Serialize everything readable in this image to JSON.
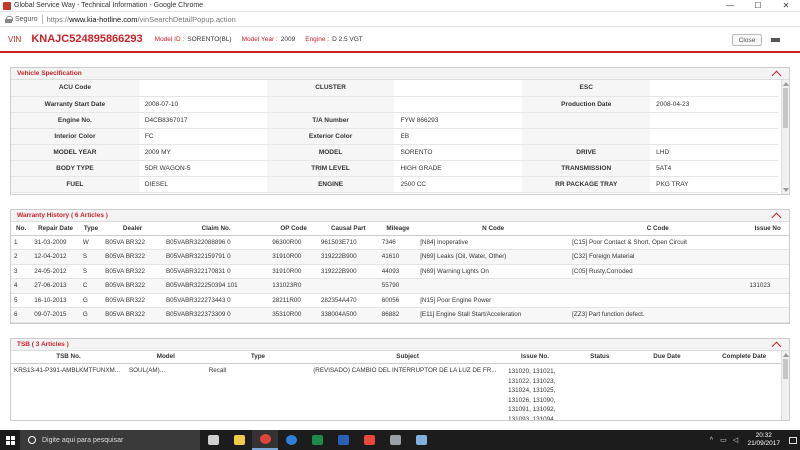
{
  "window": {
    "title": "Global Service Way - Technical Information - Google Chrome",
    "minimize": "—",
    "maximize": "☐",
    "close": "✕"
  },
  "addressbar": {
    "secure_label": "Seguro",
    "url_prefix": "https://",
    "url_host": "www.kia-hotline.com",
    "url_path": "/vinSearchDetailPopup.action"
  },
  "header": {
    "vin_label": "VIN",
    "vin_value": "KNAJC524895866293",
    "model_id_label": "Model ID :",
    "model_id_value": "SORENTO(BL)",
    "model_year_label": "Model Year :",
    "model_year_value": "2009",
    "engine_label": "Engine :",
    "engine_value": "D 2.5 VGT",
    "close_label": "Close"
  },
  "vehicle_spec": {
    "title": "Vehicle Specification",
    "rows": [
      [
        "ACU Code",
        "",
        "CLUSTER",
        "",
        "ESC",
        ""
      ],
      [
        "Warranty Start Date",
        "2008-07-10",
        "",
        "",
        "Production Date",
        "2008-04-23"
      ],
      [
        "Engine No.",
        "D4CB8367017",
        "T/A Number",
        "FYW 866293",
        "",
        ""
      ],
      [
        "Interior Color",
        "FC",
        "Exterior Color",
        "EB",
        "",
        ""
      ],
      [
        "MODEL YEAR",
        "2009 MY",
        "MODEL",
        "SORENTO",
        "DRIVE",
        "LHD"
      ],
      [
        "BODY TYPE",
        "5DR WAGON-5",
        "TRIM LEVEL",
        "HIGH GRADE",
        "TRANSMISSION",
        "5AT4"
      ],
      [
        "FUEL",
        "DIESEL",
        "ENGINE",
        "2500 CC",
        "RR PACKAGE TRAY",
        "PKG TRAY"
      ]
    ]
  },
  "warranty": {
    "title": "Warranty History ( 6 Articles )",
    "columns": [
      "No.",
      "Repair Date",
      "Type",
      "Dealer",
      "Claim No.",
      "OP Code",
      "Causal Part",
      "Mileage",
      "N Code",
      "C Code",
      "Issue No"
    ],
    "rows": [
      [
        "1",
        "31-03-2009",
        "W",
        "B05VA BR322",
        "B05VABR322088896 0",
        "96300R00",
        "961503E710",
        "7346",
        "[N84] Inoperative",
        "[C15] Poor Contact & Short, Open Circuit",
        ""
      ],
      [
        "2",
        "12-04-2012",
        "S",
        "B05VA BR322",
        "B05VABR322159791 0",
        "31910R00",
        "319222B900",
        "41610",
        "[N69] Leaks (Oil, Water, Other)",
        "[C32] Foreign Material",
        ""
      ],
      [
        "3",
        "24-05-2012",
        "S",
        "B05VA BR322",
        "B05VABR322170831 0",
        "31910R00",
        "319222B900",
        "44093",
        "[N69] Warning Lights On",
        "[C05] Rusty,Corroded",
        ""
      ],
      [
        "4",
        "27-06-2013",
        "C",
        "B05VA BR322",
        "B05VABR322250394 101",
        "131023R0",
        "",
        "55790",
        "",
        "",
        "131023"
      ],
      [
        "5",
        "16-10-2013",
        "G",
        "B05VA BR322",
        "B05VABR322273443 0",
        "28211R00",
        "282354A470",
        "60056",
        "[N15] Poor Engine Power",
        "",
        ""
      ],
      [
        "6",
        "09-07-2015",
        "G",
        "B05VA BR322",
        "B05VABR322373309 0",
        "35310R00",
        "338004A500",
        "86882",
        "[E11] Engine Stall Start/Acceleration",
        "[ZZ3] Part function defect.",
        ""
      ]
    ]
  },
  "tsb": {
    "title": "TSB ( 3 Articles )",
    "columns": [
      "TSB No.",
      "Model",
      "Type",
      "Subject",
      "Issue No.",
      "Status",
      "Due Date",
      "Complete Date"
    ],
    "rows": [
      [
        "KRS13-41-P391-AMBLKMTFUNXM...",
        "SOUL(AM)...",
        "Recall",
        "(REVISADO) CAMBIO DEL INTERRUPTOR DE LA LUZ DE FR...",
        "131020, 131021, 131022, 131023, 131024, 131025, 131026, 131090, 131091, 131092, 131093, 131094,",
        "",
        "",
        ""
      ]
    ]
  },
  "taskbar": {
    "search_placeholder": "Digite aqui para pesquisar",
    "time": "20:32",
    "date": "21/09/2017",
    "apps": [
      {
        "name": "task-view",
        "color": "#cfcfcf"
      },
      {
        "name": "file-explorer",
        "color": "#f2c94c"
      },
      {
        "name": "chrome",
        "color": "#e0453a"
      },
      {
        "name": "edge",
        "color": "#2f7fd6"
      },
      {
        "name": "excel",
        "color": "#1f8a4c"
      },
      {
        "name": "word",
        "color": "#2b5fb8"
      },
      {
        "name": "app-red",
        "color": "#e8493b"
      },
      {
        "name": "app-grey",
        "color": "#9aa0a6"
      },
      {
        "name": "app-blue",
        "color": "#7fb0e0"
      }
    ]
  },
  "colors": {
    "brand_red": "#c9232a"
  }
}
